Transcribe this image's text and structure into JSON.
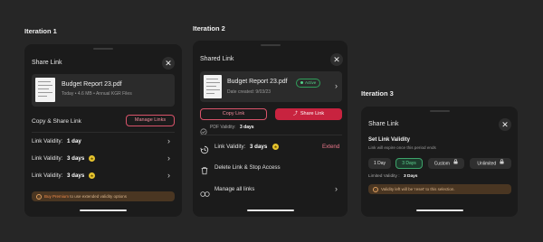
{
  "iterations": [
    {
      "title": "Iteration 1"
    },
    {
      "title": "Iteration 2"
    },
    {
      "title": "Iteration 3"
    }
  ],
  "p1": {
    "title": "Share Link",
    "close": "✕",
    "file": {
      "name": "Budget Report 23.pdf",
      "meta": "Today • 4.6 MB • Annual KGR Files"
    },
    "copy_share": "Copy & Share Link",
    "manage_links": "Manage Links",
    "rows": [
      {
        "label": "Link Validity:",
        "value": "1 day"
      },
      {
        "label": "Link Validity:",
        "value": "3 days"
      },
      {
        "label": "Link Validity:",
        "value": "3 days"
      }
    ],
    "warning": {
      "link": "Buy Premium",
      "text": " to use extended validity options"
    }
  },
  "p2": {
    "title": "Shared Link",
    "close": "✕",
    "file": {
      "name": "Budget Report 23.pdf",
      "meta": "Date created: 9/03/23",
      "status": "Active"
    },
    "copy_link": "Copy Link",
    "share_link": "Share Link",
    "pdf_validity_label": "PDF Validity:",
    "pdf_validity_value": "3 days",
    "link_validity_label": "Link Validity:",
    "link_validity_value": "3 days",
    "extend": "Extend",
    "delete": "Delete Link & Stop Access",
    "manage_all": "Manage all links"
  },
  "p3": {
    "title": "Share Link",
    "close": "✕",
    "heading": "Set Link Validity",
    "sub": "Link will expire once this period ends",
    "chips": [
      "1 Day",
      "3 Days",
      "Custom",
      "Unlimited"
    ],
    "selected": "3 Days",
    "limited_label": "Limited Validity :",
    "limited_value": "3 Days",
    "warning": "Validity left will be 'reset' to this selection."
  },
  "colors": {
    "accent_red": "#c8233f",
    "active_green": "#54d28a",
    "coin": "#e6c42e",
    "warning_bg": "#4a3622"
  }
}
